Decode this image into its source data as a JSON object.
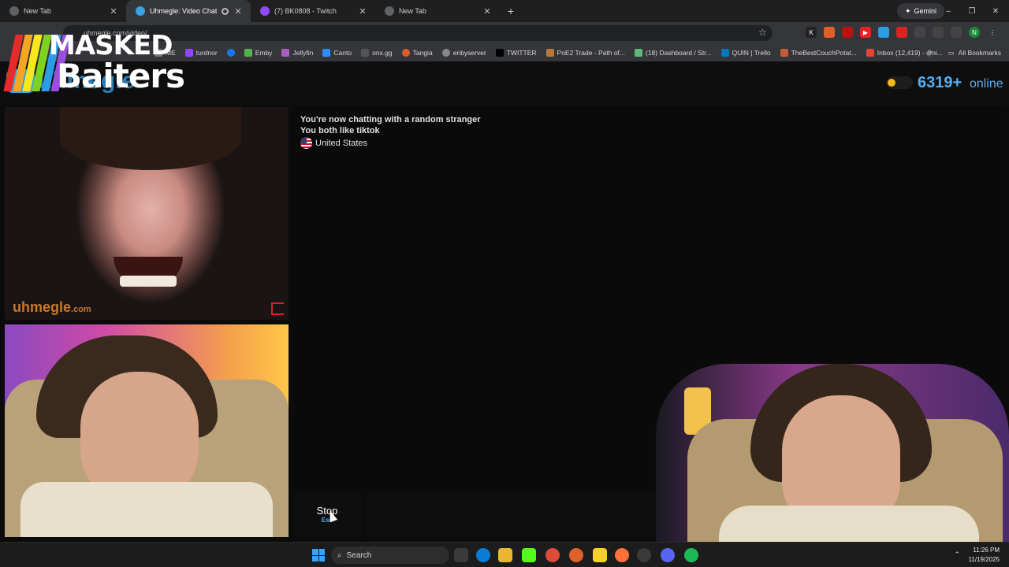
{
  "browser": {
    "tabs": [
      {
        "title": "New Tab",
        "active": false,
        "icon": "chrome-icon"
      },
      {
        "title": "Uhmegle: Video Chat | Ran",
        "active": true,
        "icon": "uhmegle-icon"
      },
      {
        "title": "(7) BK0808 - Twitch",
        "active": false,
        "icon": "twitch-icon"
      },
      {
        "title": "New Tab",
        "active": false,
        "icon": "chrome-icon"
      }
    ],
    "new_tab": "+",
    "gemini_label": "Gemini",
    "window_controls": {
      "minimize": "–",
      "maximize": "❐",
      "close": "✕"
    },
    "address": "uhmegle.com/video/",
    "bookmarks": [
      {
        "label": "ME",
        "color": "#777777"
      },
      {
        "label": "turdnor",
        "color": "#9147ff"
      },
      {
        "label": "",
        "color": "#1877f2"
      },
      {
        "label": "Emby",
        "color": "#52b54b"
      },
      {
        "label": "Jellyfin",
        "color": "#aa5cc3"
      },
      {
        "label": "Canto",
        "color": "#2d8cff"
      },
      {
        "label": "onx.gg",
        "color": "#555555"
      },
      {
        "label": "Tangia",
        "color": "#e05a2a"
      },
      {
        "label": "enbyserver",
        "color": "#888888"
      },
      {
        "label": "TWITTER",
        "color": "#000000"
      },
      {
        "label": "PoE2 Trade - Path of...",
        "color": "#b57a3a"
      },
      {
        "label": "(18) Dashboard / Str...",
        "color": "#5fb878"
      },
      {
        "label": "QUIN | Trello",
        "color": "#0079bf"
      },
      {
        "label": "TheBestCouchPotat...",
        "color": "#c65a3a"
      },
      {
        "label": "Inbox (12,419) - qmi...",
        "color": "#ea4335"
      }
    ],
    "more_bookmarks": "»",
    "all_bookmarks": "All Bookmarks"
  },
  "overlay_logo": {
    "line1": "MASKED",
    "line2": "Baiters",
    "stripe_colors": [
      "#e62b2b",
      "#f5a623",
      "#f8e71c",
      "#7ed321",
      "#2b9de6",
      "#9b4de0"
    ]
  },
  "site": {
    "name": "uhmegle",
    "online_count": "6319+",
    "online_label": "online",
    "accent": "#58aef0"
  },
  "stranger_video": {
    "watermark": "uhmegle",
    "watermark_suffix": ".com"
  },
  "chat": {
    "line1": "You're now chatting with a random stranger",
    "line2": "You both like tiktok",
    "country": "United States"
  },
  "controls": {
    "stop_label": "Stop",
    "stop_key": "Esc"
  },
  "taskbar": {
    "search_placeholder": "Search",
    "time": "11:26 PM",
    "date": "11/19/2025"
  }
}
